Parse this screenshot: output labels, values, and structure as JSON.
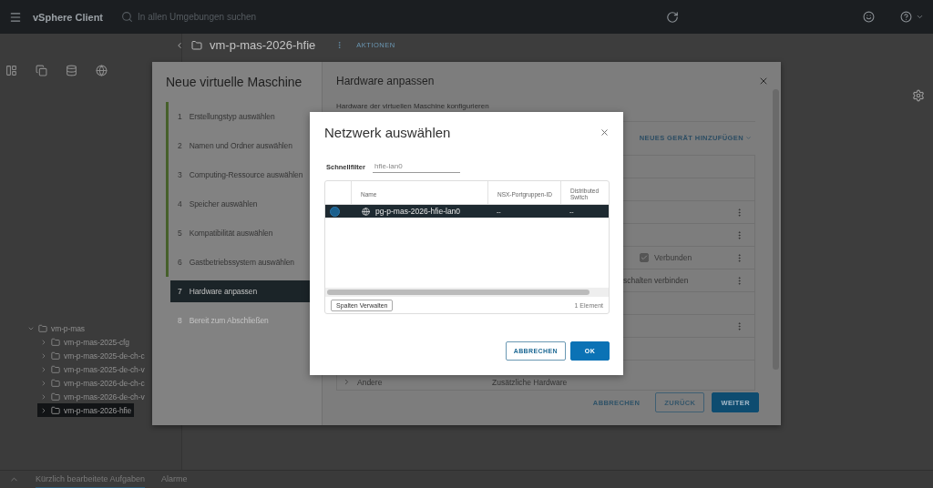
{
  "header": {
    "app_name": "vSphere Client",
    "search": {
      "placeholder": "In allen Umgebungen suchen"
    }
  },
  "breadcrumb": {
    "title": "vm-p-mas-2026-hfie",
    "action": "AKTIONEN"
  },
  "tree": [
    {
      "label": "vm-p-mas",
      "expanded": true,
      "selected": false,
      "children": [
        {
          "label": "vm-p-mas-2025-cfg",
          "expanded": false,
          "selected": false
        },
        {
          "label": "vm-p-mas-2025-de-ch-c",
          "expanded": false,
          "selected": false
        },
        {
          "label": "vm-p-mas-2025-de-ch-v",
          "expanded": false,
          "selected": false
        },
        {
          "label": "vm-p-mas-2026-de-ch-c",
          "expanded": false,
          "selected": false
        },
        {
          "label": "vm-p-mas-2026-de-ch-v",
          "expanded": false,
          "selected": false
        },
        {
          "label": "vm-p-mas-2026-hfie",
          "expanded": false,
          "selected": true
        }
      ]
    }
  ],
  "bottom_tabs": [
    {
      "label": "Kürzlich bearbeitete Aufgaben",
      "selected": true
    },
    {
      "label": "Alarme",
      "selected": false
    }
  ],
  "wizard": {
    "title": "Neue virtuelle Maschine",
    "steps": [
      {
        "number": "1",
        "label": "Erstellungstyp auswählen",
        "completed": true,
        "selected": false,
        "disabled": false
      },
      {
        "number": "2",
        "label": "Namen und Ordner auswählen",
        "completed": true,
        "selected": false,
        "disabled": false
      },
      {
        "number": "3",
        "label": "Computing-Ressource auswählen",
        "completed": true,
        "selected": false,
        "disabled": false
      },
      {
        "number": "4",
        "label": "Speicher auswählen",
        "completed": true,
        "selected": false,
        "disabled": false
      },
      {
        "number": "5",
        "label": "Kompatibilität auswählen",
        "completed": true,
        "selected": false,
        "disabled": false
      },
      {
        "number": "6",
        "label": "Gastbetriebssystem auswählen",
        "completed": true,
        "selected": false,
        "disabled": false
      },
      {
        "number": "7",
        "label": "Hardware anpassen",
        "completed": false,
        "selected": true,
        "disabled": false
      },
      {
        "number": "8",
        "label": "Bereit zum Abschließen",
        "completed": false,
        "selected": false,
        "disabled": true
      }
    ],
    "page_title": "Hardware anpassen",
    "page_subtitle": "Hardware der virtuellen Maschine konfigurieren",
    "add_device": "NEUES GERÄT HINZUFÜGEN",
    "hardware_rows": [
      {
        "kind": "blank",
        "menu": false
      },
      {
        "kind": "blank",
        "menu": false
      },
      {
        "kind": "blank",
        "menu": true
      },
      {
        "kind": "blank",
        "menu": true
      },
      {
        "kind": "check",
        "label": "Verbunden",
        "checked": true,
        "menu": true
      },
      {
        "kind": "text",
        "text": "schalten verbinden",
        "menu": true
      },
      {
        "kind": "blank",
        "menu": false
      },
      {
        "kind": "blank",
        "menu": true
      },
      {
        "kind": "blank",
        "menu": false
      },
      {
        "kind": "section",
        "label": "Andere",
        "value": "Zusätzliche Hardware",
        "expanded": false
      }
    ],
    "buttons": [
      {
        "label": "ABBRECHEN",
        "kind": "link"
      },
      {
        "label": "ZURÜCK",
        "kind": "outline"
      },
      {
        "label": "WEITER",
        "kind": "primary"
      }
    ]
  },
  "dialog": {
    "title": "Netzwerk auswählen",
    "filter": {
      "label": "Schnellfilter",
      "value": "hfie-lan0"
    },
    "columns": [
      "Name",
      "NSX-Portgruppen-ID",
      "Distributed Switch"
    ],
    "rows": [
      {
        "selected": true,
        "cells": [
          "pg-p-mas-2026-hfie-lan0",
          "--",
          "--"
        ]
      }
    ],
    "manage_columns": "Spalten Verwalten",
    "count": "1 Element",
    "buttons": [
      {
        "label": "ABBRECHEN",
        "kind": "outline"
      },
      {
        "label": "OK",
        "kind": "primary"
      }
    ]
  }
}
